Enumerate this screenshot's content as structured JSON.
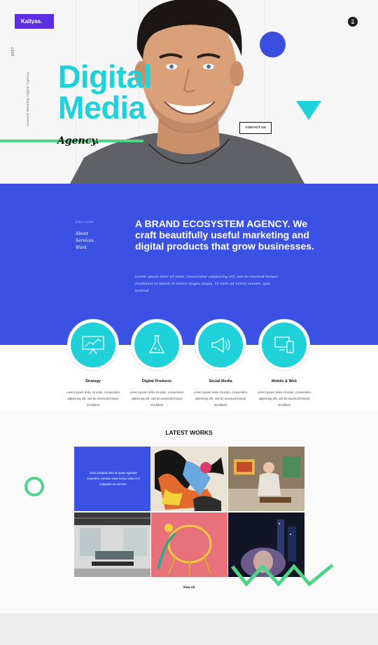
{
  "brand": {
    "logo": "Kallyas."
  },
  "hero": {
    "year": "2017",
    "award_text": "Awward Winning Digital Agency",
    "title_line1": "Digital",
    "title_line2": "Media",
    "subtitle": "Agency.",
    "contact_button": "CONTACT US"
  },
  "intro": {
    "nav_heading": "WELCOME",
    "nav_items": [
      "About",
      "Services",
      "Work"
    ],
    "headline": "A BRAND ECOSYSTEM AGENCY. We craft beautifully useful marketing and digital products that grow businesses.",
    "lead": "Lorem ipsum dolor sit amet, consectetur adipisicing elit, sed do eiusmod tempor incididunt ut labore et dolore magna aliqua. Ut enim ad minim veniam, quis nostrud"
  },
  "services": [
    {
      "name": "Strategy",
      "icon": "chart-board-icon",
      "desc": "Lorem ipsum dolor sit amet, consectetur adipiscing elit, sed do eiusmod tempor incididunt"
    },
    {
      "name": "Digital Products",
      "icon": "flask-icon",
      "desc": "Lorem ipsum dolor sit amet, consectetur adipiscing elit, sed do eiusmod tempor incididunt"
    },
    {
      "name": "Social Media",
      "icon": "megaphone-icon",
      "desc": "Lorem ipsum dolor sit amet, consectetur adipiscing elit, sed do eiusmod tempor incididunt"
    },
    {
      "name": "Mobile & Web",
      "icon": "devices-icon",
      "desc": "Lorem ipsum dolor sit amet, consectetur adipiscing elit, sed do eiusmod tempor incididunt"
    }
  ],
  "works": {
    "title": "LATEST WORKS",
    "intro_tile": "Duis volutpat ante at quam egestas imperdiet. Aenean vitae lectus vitae orci vulputate accumsan.",
    "view_all": "View All"
  },
  "colors": {
    "accent_blue": "#3a51e3",
    "cyan": "#1fd1d9",
    "green": "#4fd389",
    "purple": "#5b2ee0"
  }
}
